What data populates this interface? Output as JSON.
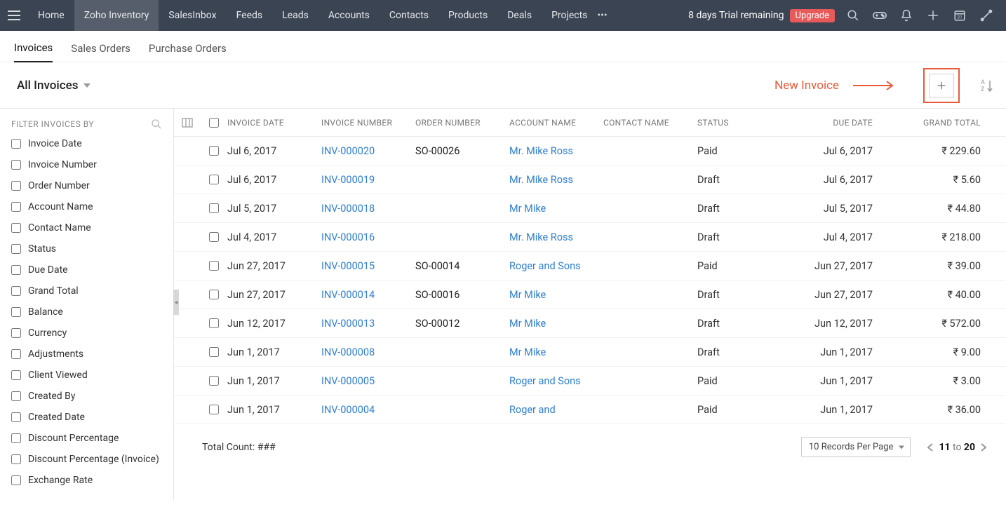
{
  "topnav": {
    "items": [
      "Home",
      "Zoho Inventory",
      "SalesInbox",
      "Feeds",
      "Leads",
      "Accounts",
      "Contacts",
      "Products",
      "Deals",
      "Projects"
    ],
    "active_index": 1,
    "trial_text": "8 days Trial remaining",
    "upgrade_label": "Upgrade"
  },
  "subtabs": {
    "items": [
      "Invoices",
      "Sales Orders",
      "Purchase Orders"
    ],
    "active_index": 0
  },
  "toolbar": {
    "view_label": "All Invoices",
    "new_invoice_callout": "New Invoice"
  },
  "sidebar": {
    "title": "FILTER INVOICES BY",
    "filters": [
      "Invoice Date",
      "Invoice Number",
      "Order Number",
      "Account Name",
      "Contact Name",
      "Status",
      "Due Date",
      "Grand Total",
      "Balance",
      "Currency",
      "Adjustments",
      "Client Viewed",
      "Created By",
      "Created Date",
      "Discount Percentage",
      "Discount Percentage (Invoice)",
      "Exchange Rate"
    ]
  },
  "table": {
    "headers": {
      "invoice_date": "INVOICE DATE",
      "invoice_number": "INVOICE NUMBER",
      "order_number": "ORDER NUMBER",
      "account_name": "ACCOUNT NAME",
      "contact_name": "CONTACT NAME",
      "status": "STATUS",
      "due_date": "DUE DATE",
      "grand_total": "GRAND TOTAL"
    },
    "rows": [
      {
        "date": "Jul 6, 2017",
        "inv": "INV-000020",
        "ord": "SO-00026",
        "acc": "Mr. Mike Ross",
        "con": "",
        "stat": "Paid",
        "due": "Jul 6, 2017",
        "total": "₹ 229.60"
      },
      {
        "date": "Jul 6, 2017",
        "inv": "INV-000019",
        "ord": "",
        "acc": "Mr. Mike Ross",
        "con": "",
        "stat": "Draft",
        "due": "Jul 6, 2017",
        "total": "₹ 5.60"
      },
      {
        "date": "Jul 5, 2017",
        "inv": "INV-000018",
        "ord": "",
        "acc": "Mr Mike",
        "con": "",
        "stat": "Draft",
        "due": "Jul 5, 2017",
        "total": "₹ 44.80"
      },
      {
        "date": "Jul 4, 2017",
        "inv": "INV-000016",
        "ord": "",
        "acc": "Mr. Mike Ross",
        "con": "",
        "stat": "Draft",
        "due": "Jul 4, 2017",
        "total": "₹ 218.00"
      },
      {
        "date": "Jun 27, 2017",
        "inv": "INV-000015",
        "ord": "SO-00014",
        "acc": "Roger and Sons",
        "con": "",
        "stat": "Paid",
        "due": "Jun 27, 2017",
        "total": "₹ 39.00"
      },
      {
        "date": "Jun 27, 2017",
        "inv": "INV-000014",
        "ord": "SO-00016",
        "acc": "Mr Mike",
        "con": "",
        "stat": "Draft",
        "due": "Jun 27, 2017",
        "total": "₹ 40.00"
      },
      {
        "date": "Jun 12, 2017",
        "inv": "INV-000013",
        "ord": "SO-00012",
        "acc": "Mr Mike",
        "con": "",
        "stat": "Draft",
        "due": "Jun 12, 2017",
        "total": "₹ 572.00"
      },
      {
        "date": "Jun 1, 2017",
        "inv": "INV-000008",
        "ord": "",
        "acc": "Mr Mike",
        "con": "",
        "stat": "Draft",
        "due": "Jun 1, 2017",
        "total": "₹ 9.00"
      },
      {
        "date": "Jun 1, 2017",
        "inv": "INV-000005",
        "ord": "",
        "acc": "Roger and Sons",
        "con": "",
        "stat": "Paid",
        "due": "Jun 1, 2017",
        "total": "₹ 3.00"
      },
      {
        "date": "Jun 1, 2017",
        "inv": "INV-000004",
        "ord": "",
        "acc": "Roger and",
        "con": "",
        "stat": "Paid",
        "due": "Jun 1, 2017",
        "total": "₹ 36.00"
      }
    ]
  },
  "footer": {
    "total_count_label": "Total Count: ###",
    "per_page": "10 Records Per Page",
    "page_from": "11",
    "page_sep": "to",
    "page_to": "20"
  }
}
